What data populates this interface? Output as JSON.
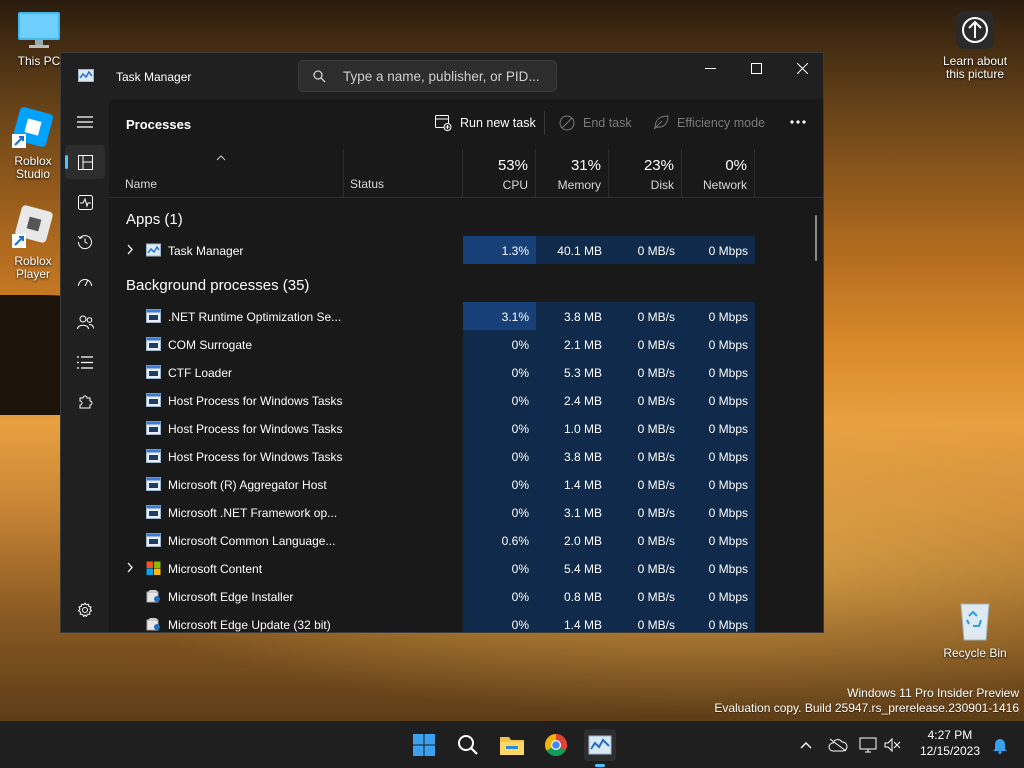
{
  "desktop": {
    "icons": [
      {
        "label": "This PC"
      },
      {
        "label": "Roblox Studio"
      },
      {
        "label": "Roblox Player"
      },
      {
        "label": "Learn about this picture"
      },
      {
        "label": "Recycle Bin"
      }
    ],
    "watermark": {
      "line1": "Windows 11 Pro Insider Preview",
      "line2": "Evaluation copy. Build 25947.rs_prerelease.230901-1416"
    }
  },
  "window": {
    "title": "Task Manager",
    "search_placeholder": "Type a name, publisher, or PID..."
  },
  "toolbar": {
    "page_title": "Processes",
    "run_new_task": "Run new task",
    "end_task": "End task",
    "efficiency_mode": "Efficiency mode"
  },
  "columns": {
    "name": "Name",
    "status": "Status",
    "cpu": {
      "pct": "53%",
      "label": "CPU"
    },
    "memory": {
      "pct": "31%",
      "label": "Memory"
    },
    "disk": {
      "pct": "23%",
      "label": "Disk"
    },
    "network": {
      "pct": "0%",
      "label": "Network"
    }
  },
  "groups": {
    "apps": "Apps (1)",
    "background": "Background processes (35)"
  },
  "apps": [
    {
      "name": "Task Manager",
      "cpu": "1.3%",
      "memory": "40.1 MB",
      "disk": "0 MB/s",
      "network": "0 Mbps"
    }
  ],
  "background": [
    {
      "name": ".NET Runtime Optimization Se...",
      "cpu": "3.1%",
      "memory": "3.8 MB",
      "disk": "0 MB/s",
      "network": "0 Mbps"
    },
    {
      "name": "COM Surrogate",
      "cpu": "0%",
      "memory": "2.1 MB",
      "disk": "0 MB/s",
      "network": "0 Mbps"
    },
    {
      "name": "CTF Loader",
      "cpu": "0%",
      "memory": "5.3 MB",
      "disk": "0 MB/s",
      "network": "0 Mbps"
    },
    {
      "name": "Host Process for Windows Tasks",
      "cpu": "0%",
      "memory": "2.4 MB",
      "disk": "0 MB/s",
      "network": "0 Mbps"
    },
    {
      "name": "Host Process for Windows Tasks",
      "cpu": "0%",
      "memory": "1.0 MB",
      "disk": "0 MB/s",
      "network": "0 Mbps"
    },
    {
      "name": "Host Process for Windows Tasks",
      "cpu": "0%",
      "memory": "3.8 MB",
      "disk": "0 MB/s",
      "network": "0 Mbps"
    },
    {
      "name": "Microsoft (R) Aggregator Host",
      "cpu": "0%",
      "memory": "1.4 MB",
      "disk": "0 MB/s",
      "network": "0 Mbps"
    },
    {
      "name": "Microsoft .NET Framework op...",
      "cpu": "0%",
      "memory": "3.1 MB",
      "disk": "0 MB/s",
      "network": "0 Mbps"
    },
    {
      "name": "Microsoft Common Language...",
      "cpu": "0.6%",
      "memory": "2.0 MB",
      "disk": "0 MB/s",
      "network": "0 Mbps"
    },
    {
      "name": "Microsoft Content",
      "cpu": "0%",
      "memory": "5.4 MB",
      "disk": "0 MB/s",
      "network": "0 Mbps"
    },
    {
      "name": "Microsoft Edge Installer",
      "cpu": "0%",
      "memory": "0.8 MB",
      "disk": "0 MB/s",
      "network": "0 Mbps"
    },
    {
      "name": "Microsoft Edge Update (32 bit)",
      "cpu": "0%",
      "memory": "1.4 MB",
      "disk": "0 MB/s",
      "network": "0 Mbps"
    }
  ],
  "clock": {
    "time": "4:27 PM",
    "date": "12/15/2023"
  },
  "colors": {
    "accent": "#4cc2ff",
    "cell_light": "#0f2a4a",
    "cell_strong": "#173f78",
    "window_bg": "#202020",
    "taskbar_bg": "#1f1f1f"
  }
}
